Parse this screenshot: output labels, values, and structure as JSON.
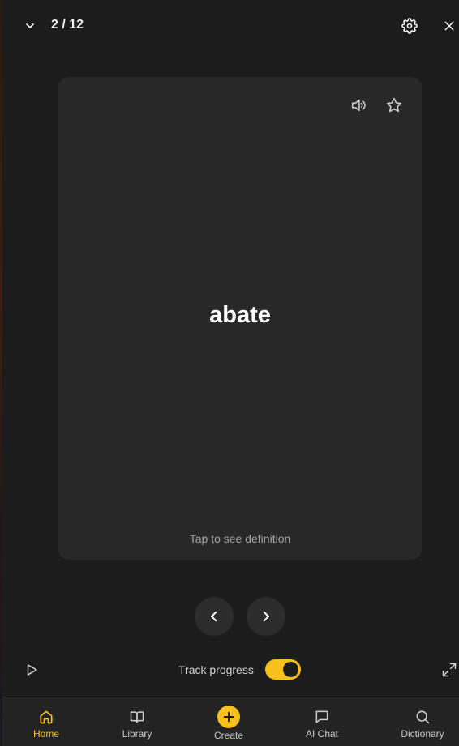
{
  "header": {
    "counter": "2 / 12",
    "icons": [
      "chevron-down-icon",
      "gear-icon",
      "close-icon"
    ]
  },
  "card": {
    "word": "abate",
    "hint": "Tap to see definition",
    "icons": [
      "speaker-icon",
      "star-icon"
    ]
  },
  "controls": {
    "track_label": "Track progress",
    "track_enabled": true
  },
  "nav": {
    "items": [
      {
        "label": "Home",
        "icon": "home-icon",
        "active": true
      },
      {
        "label": "Library",
        "icon": "book-icon",
        "active": false
      },
      {
        "label": "Create",
        "icon": "plus-icon",
        "active": false
      },
      {
        "label": "AI Chat",
        "icon": "chat-icon",
        "active": false
      },
      {
        "label": "Dictionary",
        "icon": "search-icon",
        "active": false
      }
    ]
  },
  "colors": {
    "accent": "#f7c01a",
    "background": "#1c1c1c",
    "card": "#282828"
  }
}
